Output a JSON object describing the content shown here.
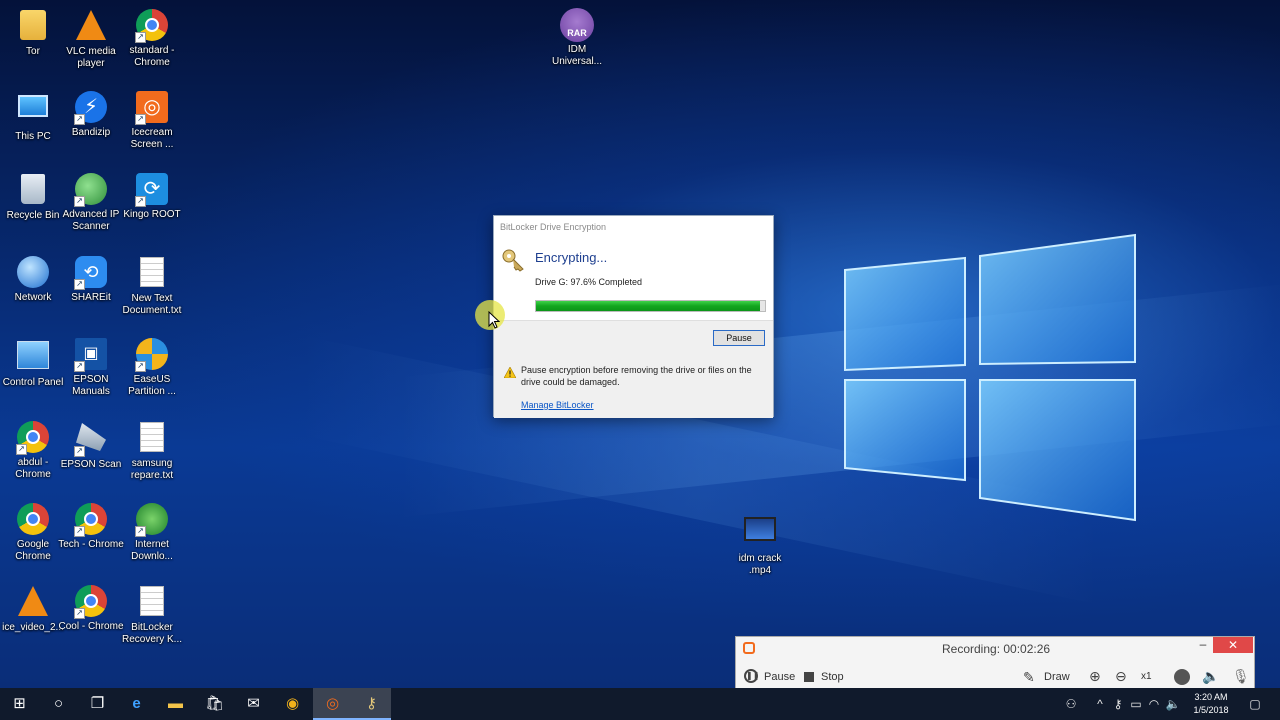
{
  "desktop_icons": [
    {
      "label": "Tor"
    },
    {
      "label": "VLC media player"
    },
    {
      "label": "standard - Chrome"
    },
    {
      "label": "IDM Universal..."
    },
    {
      "label": "This PC"
    },
    {
      "label": "Bandizip"
    },
    {
      "label": "Icecream Screen ..."
    },
    {
      "label": "Recycle Bin"
    },
    {
      "label": "Advanced IP Scanner"
    },
    {
      "label": "Kingo ROOT"
    },
    {
      "label": "Network"
    },
    {
      "label": "SHAREit"
    },
    {
      "label": "New Text Document.txt"
    },
    {
      "label": "Control Panel"
    },
    {
      "label": "EPSON Manuals"
    },
    {
      "label": "EaseUS Partition ..."
    },
    {
      "label": "abdul - Chrome"
    },
    {
      "label": "EPSON Scan"
    },
    {
      "label": "samsung repare.txt"
    },
    {
      "label": "Google Chrome"
    },
    {
      "label": "Tech - Chrome"
    },
    {
      "label": "Internet Downlo..."
    },
    {
      "label": "idm crack .mp4"
    },
    {
      "label": "ice_video_2..."
    },
    {
      "label": "Cool - Chrome"
    },
    {
      "label": "BitLocker Recovery K..."
    }
  ],
  "rar_badge": "RAR",
  "bitlocker": {
    "window_title": "BitLocker Drive Encryption",
    "heading": "Encrypting...",
    "status": "Drive G: 97.6% Completed",
    "progress_fraction": 0.976,
    "pause_button": "Pause",
    "warning": "Pause encryption before removing the drive or files on the drive could be damaged.",
    "manage_link": "Manage BitLocker"
  },
  "recorder": {
    "time_label": "Recording:  00:02:26",
    "pause_label": "Pause",
    "stop_label": "Stop",
    "draw_label": "Draw",
    "zoom_label": "x1"
  },
  "taskbar": {
    "clock_time": "3:20 AM",
    "clock_date": "1/5/2018"
  },
  "colors": {
    "progress_green": "#12a61f",
    "link_blue": "#0b56c6",
    "heading_blue": "#1e3f8f",
    "recorder_close_red": "#e04848"
  }
}
